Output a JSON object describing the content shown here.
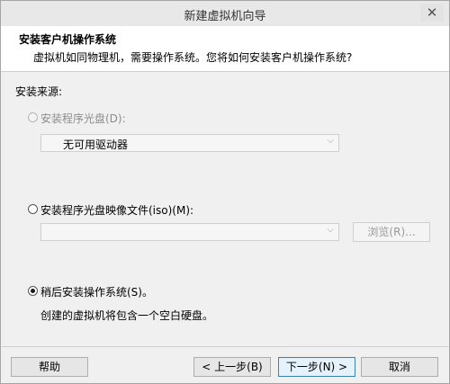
{
  "window": {
    "title": "新建虚拟机向导",
    "close_glyph": "✕"
  },
  "header": {
    "title": "安装客户机操作系统",
    "description": "虚拟机如同物理机，需要操作系统。您将如何安装客户机操作系统?"
  },
  "source": {
    "label": "安装来源:",
    "disc": {
      "label": "安装程序光盘(D):",
      "selected": false,
      "enabled": false,
      "drive_value": "无可用驱动器"
    },
    "iso": {
      "label": "安装程序光盘映像文件(iso)(M):",
      "selected": false,
      "path_value": "",
      "browse_label": "浏览(R)..."
    },
    "later": {
      "label": "稍后安装操作系统(S)。",
      "selected": true,
      "note": "创建的虚拟机将包含一个空白硬盘。"
    }
  },
  "footer": {
    "help_label": "帮助",
    "back_label": "< 上一步(B)",
    "next_label": "下一步(N) >",
    "cancel_label": "取消"
  },
  "icons": {
    "dropdown": "chevron-down-icon",
    "close": "close-icon"
  }
}
